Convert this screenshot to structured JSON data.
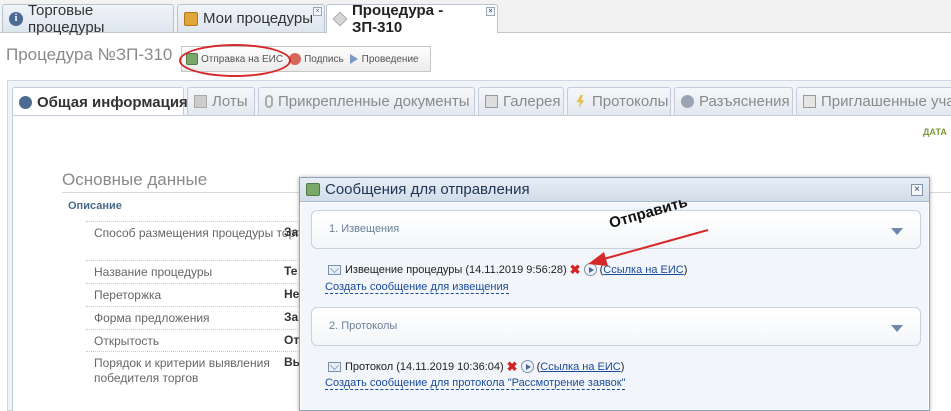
{
  "top_tabs": [
    {
      "label": "Торговые процедуры",
      "icon": "info-icon"
    },
    {
      "label": "Мои процедуры",
      "icon": "folder-icon",
      "close": "×"
    },
    {
      "label": "Процедура - ЗП-310",
      "icon": "box-icon",
      "close": "×"
    }
  ],
  "header": {
    "title": "Процедура №ЗП-310",
    "actions": [
      "Отправка на ЕИС",
      "Подпись",
      "Проведение"
    ]
  },
  "section_tabs": [
    "Общая информация",
    "Лоты",
    "Прикрепленные документы",
    "Галерея",
    "Протоколы",
    "Разъяснения",
    "Приглашенные участ"
  ],
  "content": {
    "date_label": "ДАТА",
    "section_title": "Основные данные",
    "desc_label": "Описание",
    "fields": [
      {
        "label": "Способ размещения процедуры торгов",
        "value": "За"
      },
      {
        "label": "Название процедуры",
        "value": "Те"
      },
      {
        "label": "Переторжка",
        "value": "Не"
      },
      {
        "label": "Форма предложения",
        "value": "За"
      },
      {
        "label": "Открытость",
        "value": "От"
      },
      {
        "label": "Порядок и критерии выявления победителя торгов",
        "value": "Вь"
      }
    ]
  },
  "dialog": {
    "title": "Сообщения для отправления",
    "close": "×",
    "group1": {
      "title": "1. Извещения",
      "message": "Извещение процедуры (14.11.2019 9:56:28)",
      "link": "Ссылка на ЕИС",
      "create": "Создать сообщение для извещения"
    },
    "group2": {
      "title": "2. Протоколы",
      "message": "Протокол (14.11.2019 10:36:04)",
      "link": "Ссылка на ЕИС",
      "create": "Создать сообщение для протокола \"Рассмотрение заявок\""
    }
  },
  "annotation": {
    "text": "Отправить",
    "color": "#d62828"
  },
  "colors": {
    "accent": "#1a4a9a",
    "annotation_red": "#d62828",
    "dialog_header": "#d2ddea"
  }
}
